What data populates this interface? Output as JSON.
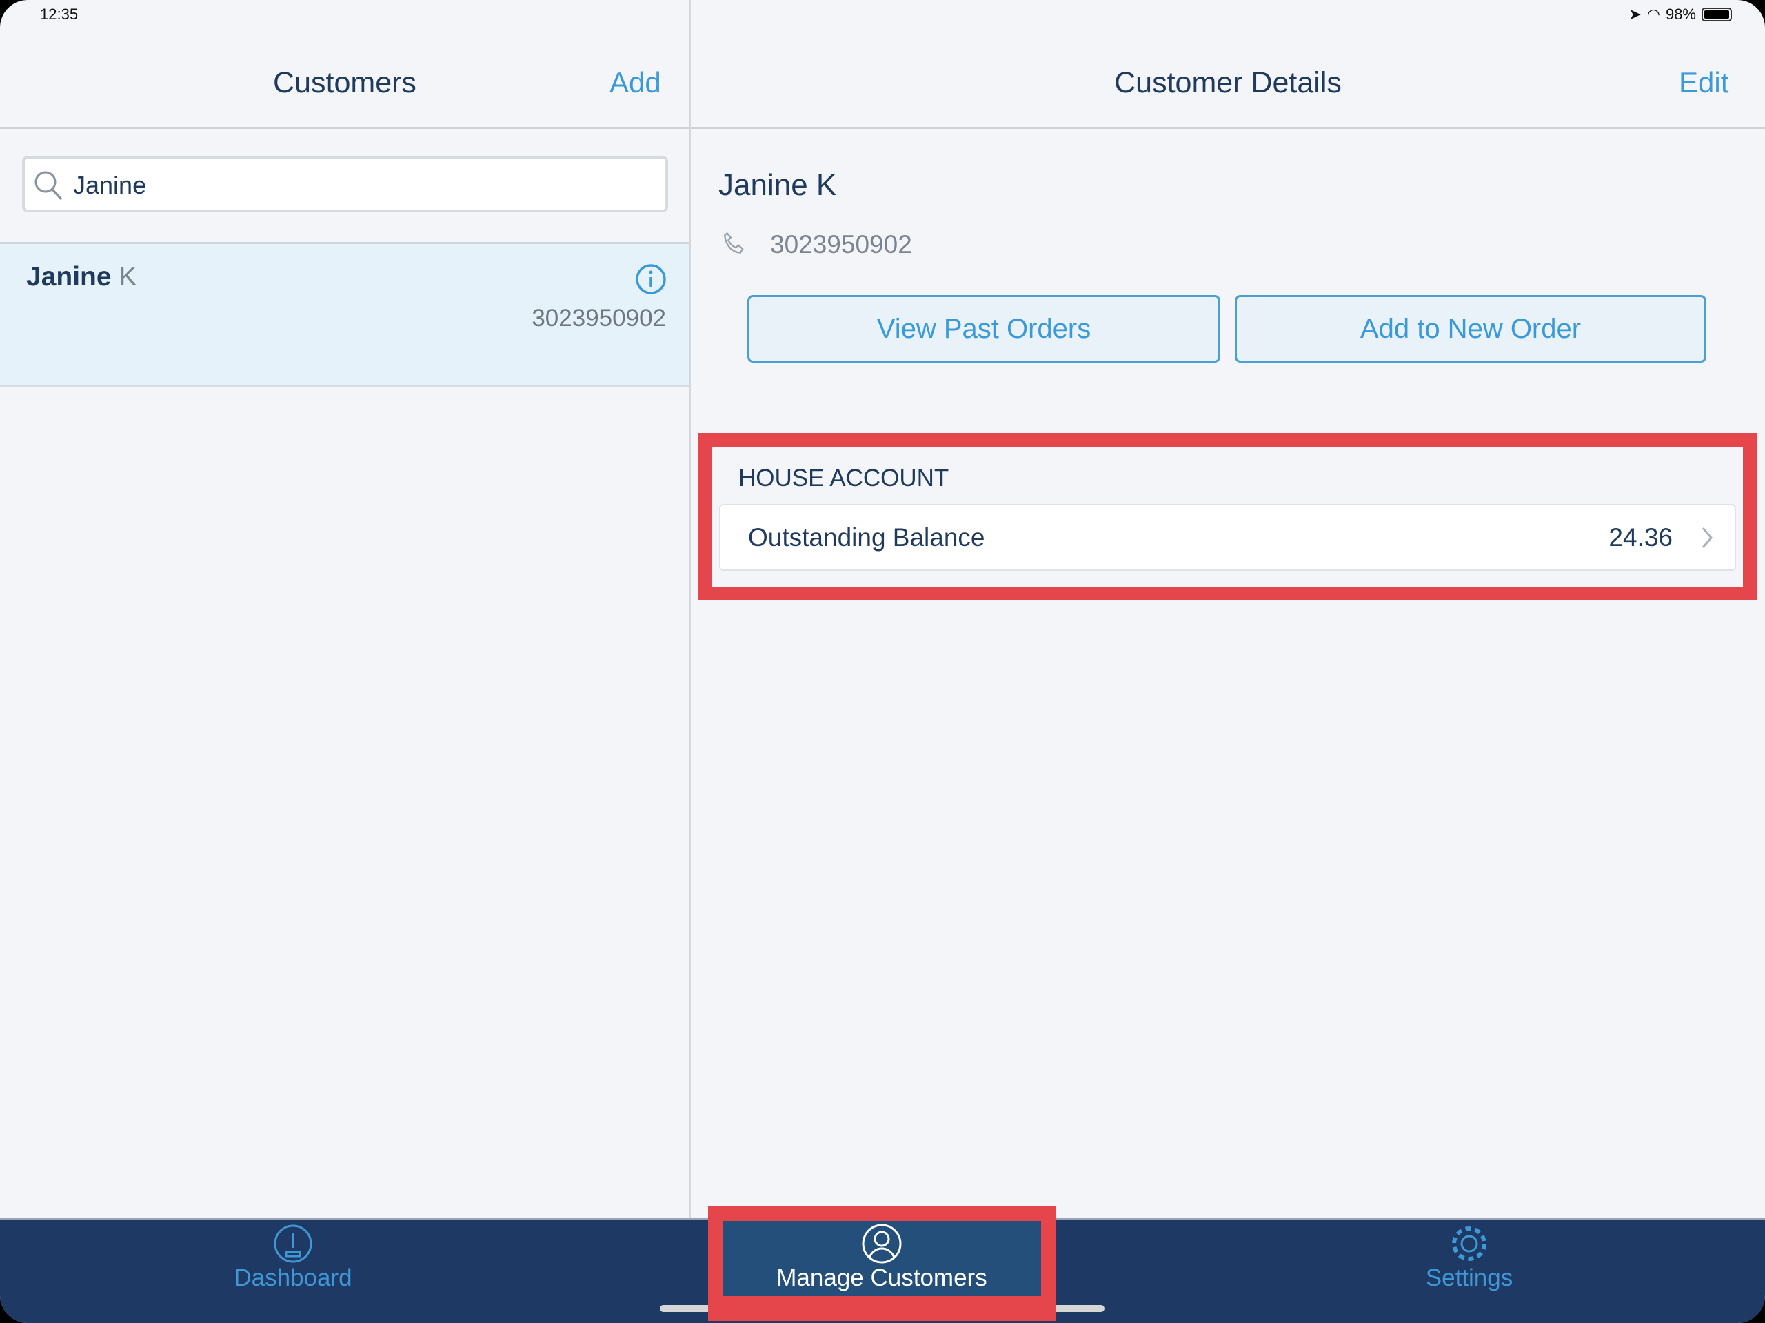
{
  "status_bar": {
    "time": "12:35",
    "battery": "98%"
  },
  "left": {
    "title": "Customers",
    "add_label": "Add",
    "search": {
      "value": "Janine",
      "placeholder": ""
    },
    "customers": [
      {
        "first": "Janine",
        "last": "K",
        "phone": "3023950902"
      }
    ]
  },
  "right": {
    "title": "Customer Details",
    "edit_label": "Edit",
    "name": "Janine K",
    "phone": "3023950902",
    "view_past_orders": "View Past Orders",
    "add_to_new_order": "Add to New Order",
    "house_account": {
      "header": "HOUSE ACCOUNT",
      "label": "Outstanding Balance",
      "value": "24.36"
    }
  },
  "tabs": [
    {
      "label": "Dashboard",
      "icon": "dashboard-gauge-icon"
    },
    {
      "label": "Manage Customers",
      "icon": "user-circle-icon",
      "active": true
    },
    {
      "label": "Settings",
      "icon": "gear-icon"
    }
  ],
  "colors": {
    "accent": "#3a9ad9",
    "tabbar": "#1e3a64",
    "highlight": "#e5464b"
  }
}
